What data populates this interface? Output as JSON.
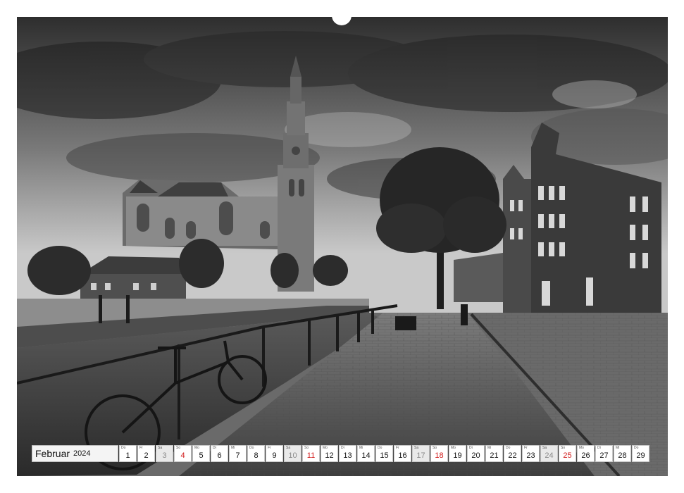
{
  "calendar": {
    "month": "Februar",
    "year": "2024",
    "days": [
      {
        "wd": "Do",
        "n": "1",
        "type": "weekday"
      },
      {
        "wd": "Fr",
        "n": "2",
        "type": "weekday"
      },
      {
        "wd": "Sa",
        "n": "3",
        "type": "sat"
      },
      {
        "wd": "So",
        "n": "4",
        "type": "sun"
      },
      {
        "wd": "Mo",
        "n": "5",
        "type": "weekday"
      },
      {
        "wd": "Di",
        "n": "6",
        "type": "weekday"
      },
      {
        "wd": "Mi",
        "n": "7",
        "type": "weekday"
      },
      {
        "wd": "Do",
        "n": "8",
        "type": "weekday"
      },
      {
        "wd": "Fr",
        "n": "9",
        "type": "weekday"
      },
      {
        "wd": "Sa",
        "n": "10",
        "type": "sat"
      },
      {
        "wd": "So",
        "n": "11",
        "type": "sun"
      },
      {
        "wd": "Mo",
        "n": "12",
        "type": "weekday"
      },
      {
        "wd": "Di",
        "n": "13",
        "type": "weekday"
      },
      {
        "wd": "Mi",
        "n": "14",
        "type": "weekday"
      },
      {
        "wd": "Do",
        "n": "15",
        "type": "weekday"
      },
      {
        "wd": "Fr",
        "n": "16",
        "type": "weekday"
      },
      {
        "wd": "Sa",
        "n": "17",
        "type": "sat"
      },
      {
        "wd": "So",
        "n": "18",
        "type": "sun"
      },
      {
        "wd": "Mo",
        "n": "19",
        "type": "weekday"
      },
      {
        "wd": "Di",
        "n": "20",
        "type": "weekday"
      },
      {
        "wd": "Mi",
        "n": "21",
        "type": "weekday"
      },
      {
        "wd": "Do",
        "n": "22",
        "type": "weekday"
      },
      {
        "wd": "Fr",
        "n": "23",
        "type": "weekday"
      },
      {
        "wd": "Sa",
        "n": "24",
        "type": "sat"
      },
      {
        "wd": "So",
        "n": "25",
        "type": "sun"
      },
      {
        "wd": "Mo",
        "n": "26",
        "type": "weekday"
      },
      {
        "wd": "Di",
        "n": "27",
        "type": "weekday"
      },
      {
        "wd": "Mi",
        "n": "28",
        "type": "weekday"
      },
      {
        "wd": "Do",
        "n": "29",
        "type": "weekday"
      }
    ]
  },
  "colors": {
    "sunday": "#d11a1a",
    "saturday": "#8a8a8a",
    "weekday": "#111111"
  }
}
